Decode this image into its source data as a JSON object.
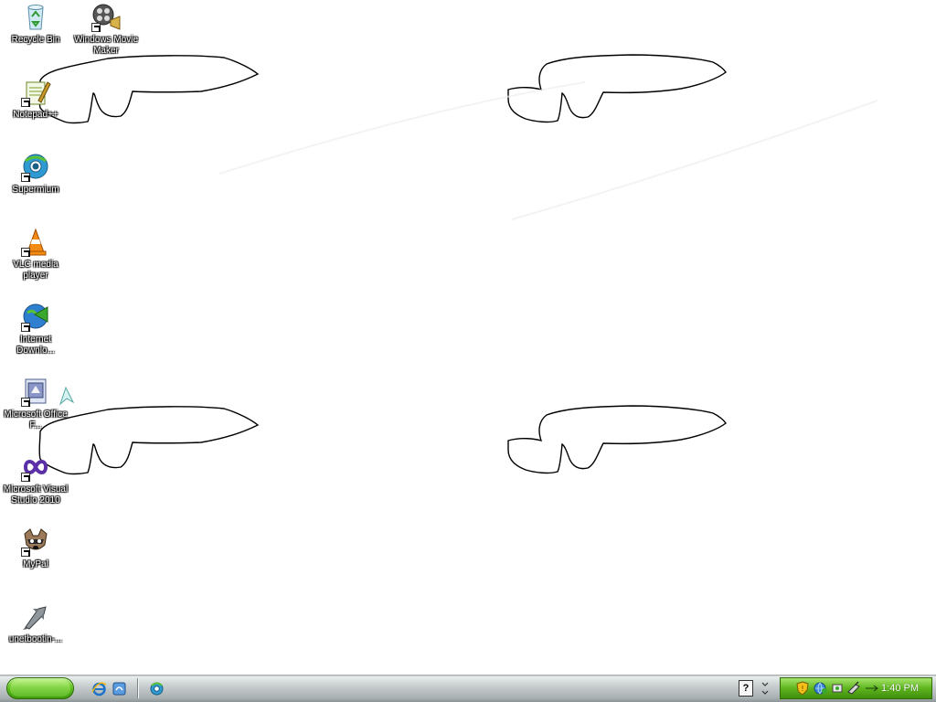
{
  "desktop": {
    "icons": [
      {
        "label": "Recycle Bin",
        "icon": "recycle-bin-icon"
      },
      {
        "label": "Windows Movie Maker",
        "icon": "movie-maker-icon"
      },
      {
        "label": "Notepad++",
        "icon": "notepad-plus-plus-icon"
      },
      {
        "label": "Supermium",
        "icon": "supermium-icon"
      },
      {
        "label": "VLC media player",
        "icon": "vlc-cone-icon"
      },
      {
        "label": "Internet Downlo...",
        "icon": "internet-download-manager-icon"
      },
      {
        "label": "Microsoft Office F...",
        "icon": "office-file-icon"
      },
      {
        "label": "Microsoft Visual Studio 2010",
        "icon": "visual-studio-icon"
      },
      {
        "label": "MyPal",
        "icon": "mypal-raccoon-icon"
      },
      {
        "label": "unetbootin-...",
        "icon": "unetbootin-icon"
      }
    ]
  },
  "taskbar": {
    "start_button": {
      "icon": "start-orb-icon",
      "color": "#5ec21b"
    },
    "quick_launch": [
      "internet-explorer-icon",
      "show-desktop-icon",
      "supermium-quicklaunch-icon"
    ],
    "tray": {
      "help_label": "?",
      "icons": [
        "security-shield-icon",
        "network-icon",
        "connection-icon",
        "safely-remove-icon",
        "volume-icon"
      ],
      "clock": "1:40 PM"
    }
  },
  "colors": {
    "tray_green": "#5fb51e",
    "taskbar_gray": "#c9cfd0"
  }
}
